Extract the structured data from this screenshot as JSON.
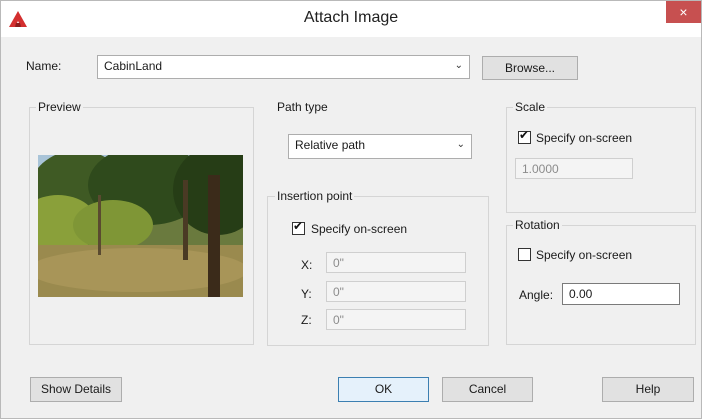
{
  "window": {
    "title": "Attach Image",
    "close_glyph": "×"
  },
  "name_row": {
    "label": "Name:",
    "value": "CabinLand",
    "browse_label": "Browse..."
  },
  "preview": {
    "title": "Preview"
  },
  "path_type": {
    "title": "Path type",
    "value": "Relative path"
  },
  "insertion_point": {
    "title": "Insertion point",
    "specify_label": "Specify on-screen",
    "specify_checked": true,
    "x_label": "X:",
    "x_value": "0\"",
    "y_label": "Y:",
    "y_value": "0\"",
    "z_label": "Z:",
    "z_value": "0\""
  },
  "scale": {
    "title": "Scale",
    "specify_label": "Specify on-screen",
    "specify_checked": true,
    "value": "1.0000"
  },
  "rotation": {
    "title": "Rotation",
    "specify_label": "Specify on-screen",
    "specify_checked": false,
    "angle_label": "Angle:",
    "angle_value": "0.00"
  },
  "buttons": {
    "show_details": "Show Details",
    "ok": "OK",
    "cancel": "Cancel",
    "help": "Help"
  },
  "icons": {
    "app": "autocad-icon",
    "close": "close-icon",
    "dropdown": "chevron-down-icon",
    "check": "checkmark-icon"
  },
  "colors": {
    "close_bg": "#c75050",
    "app_icon": "#d32f2f",
    "default_button_border": "#3c7fb1"
  }
}
